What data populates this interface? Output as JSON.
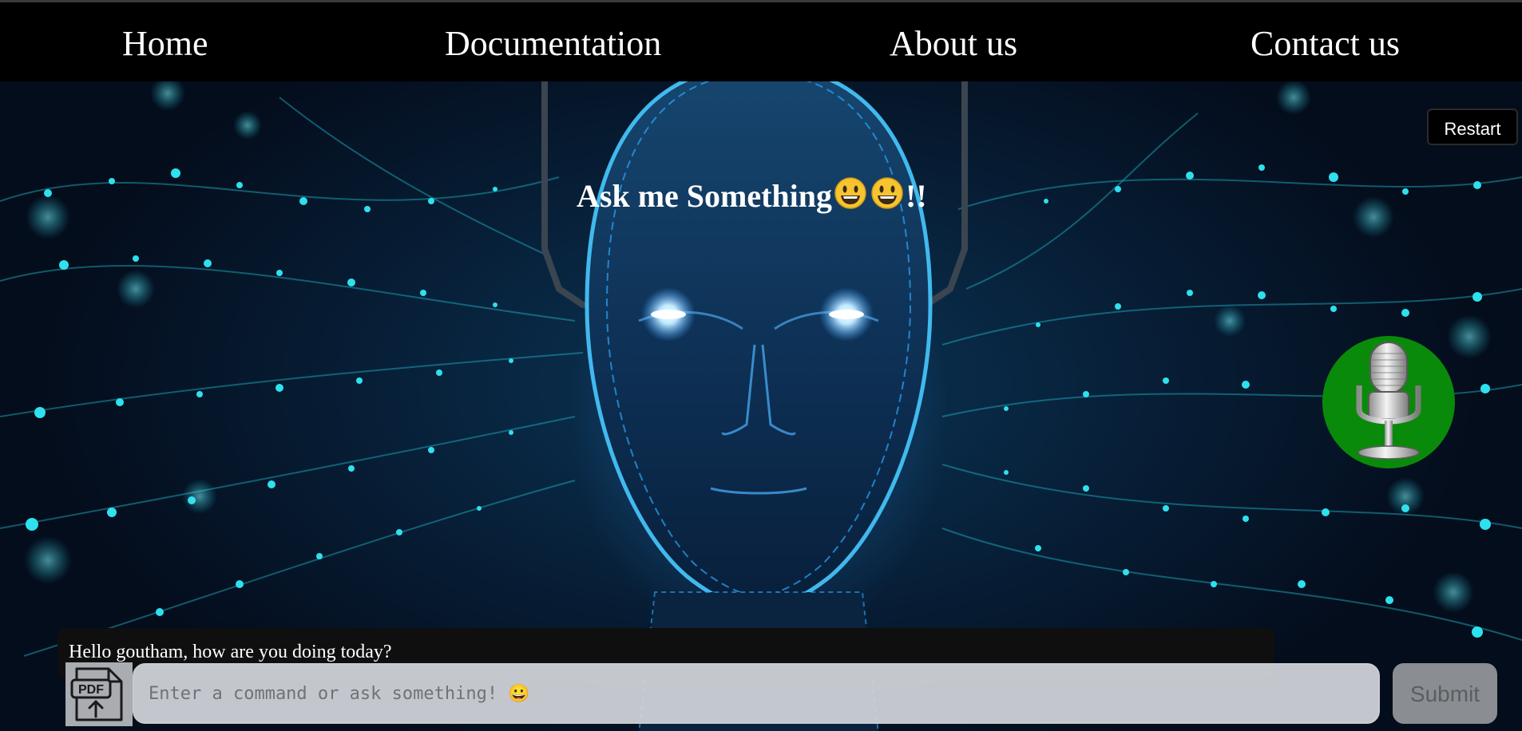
{
  "nav": {
    "items": [
      {
        "label": "Home"
      },
      {
        "label": "Documentation"
      },
      {
        "label": "About us"
      },
      {
        "label": "Contact us"
      }
    ]
  },
  "toolbar": {
    "restart_label": "Restart"
  },
  "hero": {
    "heading": "Ask me Something",
    "heading_suffix": "!!",
    "heading_emoji": "smiley-icon",
    "background": "ai-head-icon"
  },
  "mic": {
    "icon": "microphone-icon",
    "color": "#0a8a0a"
  },
  "chat": {
    "messages": [
      {
        "text": "Hello goutham, how are you doing today?"
      }
    ]
  },
  "composer": {
    "upload_icon": "pdf-upload-icon",
    "input_placeholder": "Enter a command or ask something! 😀",
    "input_value": "",
    "submit_label": "Submit"
  }
}
